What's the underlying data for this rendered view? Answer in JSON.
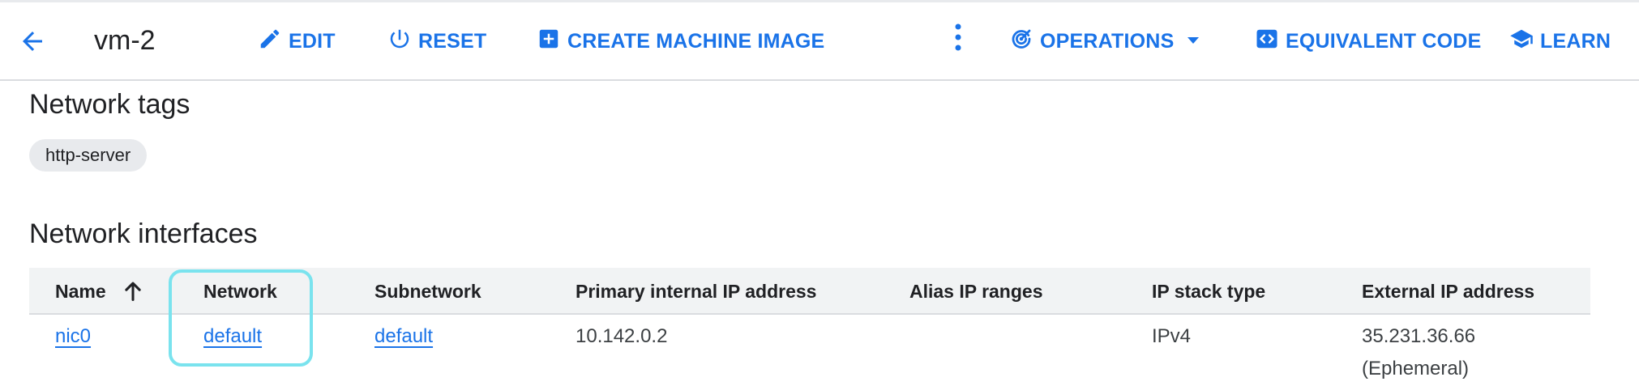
{
  "header": {
    "instance_name": "vm-2",
    "actions": {
      "edit": "EDIT",
      "reset": "RESET",
      "create_machine_image": "CREATE MACHINE IMAGE",
      "operations": "OPERATIONS",
      "equivalent_code": "EQUIVALENT CODE",
      "learn": "LEARN"
    }
  },
  "network_tags": {
    "title": "Network tags",
    "tags": [
      "http-server"
    ]
  },
  "network_interfaces": {
    "title": "Network interfaces",
    "columns": [
      "Name",
      "Network",
      "Subnetwork",
      "Primary internal IP address",
      "Alias IP ranges",
      "IP stack type",
      "External IP address"
    ],
    "rows": [
      {
        "name": "nic0",
        "network": "default",
        "subnetwork": "default",
        "primary_ip": "10.142.0.2",
        "alias_ip_ranges": "",
        "ip_stack_type": "IPv4",
        "external_ip": "35.231.36.66",
        "external_ip_type": "(Ephemeral)"
      }
    ]
  },
  "colors": {
    "accent": "#1a73e8",
    "highlight": "#7ae3ee",
    "header_bg": "#f1f3f4",
    "chip_bg": "#e8eaed"
  }
}
